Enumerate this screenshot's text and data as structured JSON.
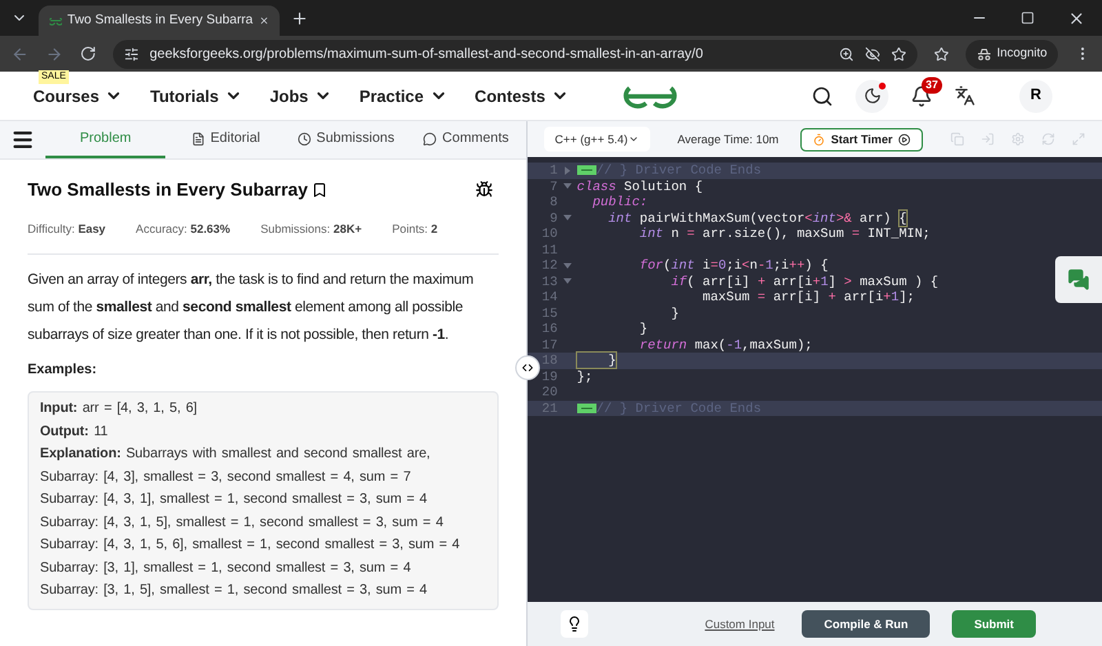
{
  "browser": {
    "tab_title": "Two Smallests in Every Subarra",
    "url": "geeksforgeeks.org/problems/maximum-sum-of-smallest-and-second-smallest-in-an-array/0",
    "incognito_label": "Incognito"
  },
  "nav": {
    "items": [
      {
        "label": "Courses",
        "badge": "SALE"
      },
      {
        "label": "Tutorials"
      },
      {
        "label": "Jobs"
      },
      {
        "label": "Practice"
      },
      {
        "label": "Contests"
      }
    ],
    "notifications": "37",
    "avatar": "R"
  },
  "problem_tabs": [
    {
      "label": "Problem",
      "kind": "problem",
      "selected": true
    },
    {
      "label": "Editorial",
      "kind": "editorial",
      "selected": false
    },
    {
      "label": "Submissions",
      "kind": "submissions",
      "selected": false
    },
    {
      "label": "Comments",
      "kind": "comments",
      "selected": false
    }
  ],
  "problem": {
    "title": "Two Smallests in Every Subarray",
    "meta": [
      {
        "label": "Difficulty: ",
        "value": "Easy"
      },
      {
        "label": "Accuracy: ",
        "value": "52.63%"
      },
      {
        "label": "Submissions: ",
        "value": "28K+"
      },
      {
        "label": "Points: ",
        "value": "2"
      }
    ],
    "description": "Given an array of integers **arr,** the task is to find and return the maximum sum of the **smallest** and **second smallest** element among all possible subarrays of size greater than one. If it is not possible, then return **-1**.",
    "examples_heading": "Examples:",
    "example_lines": [
      "**Input:** arr = [4, 3, 1, 5, 6]",
      "**Output:** 11",
      "**Explanation:** Subarrays with smallest and second smallest are,",
      "Subarray: [4, 3], smallest = 3, second smallest = 4, sum = 7",
      "Subarray: [4, 3, 1], smallest = 1, second smallest = 3, sum = 4",
      "Subarray: [4, 3, 1, 5], smallest = 1, second smallest = 3, sum = 4",
      "Subarray: [4, 3, 1, 5, 6], smallest = 1, second smallest = 3, sum = 4",
      "Subarray: [3, 1], smallest = 1, second smallest = 3, sum = 4",
      "Subarray: [3, 1, 5], smallest = 1, second smallest = 3, sum = 4"
    ]
  },
  "editor": {
    "language": "C++ (g++ 5.4)",
    "average_time": "Average Time: 10m",
    "timer_button": "Start Timer",
    "custom_input": "Custom Input",
    "compile_button": "Compile & Run",
    "submit_button": "Submit",
    "lines": [
      {
        "number": "1",
        "foldable": true,
        "folded": true,
        "highlighted": true,
        "tokens": [
          {
            "kind": "comment",
            "text": "// } Driver Code Ends"
          }
        ]
      },
      {
        "number": "7",
        "foldable": true,
        "folded": false,
        "highlighted": false,
        "tokens": [
          {
            "kind": "keyword",
            "text": "class"
          },
          {
            "kind": "plain",
            "text": " Solution {"
          }
        ]
      },
      {
        "number": "8",
        "foldable": false,
        "folded": false,
        "highlighted": false,
        "tokens": [
          {
            "kind": "keyword",
            "text": "  public:"
          }
        ]
      },
      {
        "number": "9",
        "foldable": true,
        "folded": false,
        "highlighted": false,
        "tokens": [
          {
            "kind": "type",
            "text": "    int"
          },
          {
            "kind": "plain",
            "text": " pairWithMaxSum(vector"
          },
          {
            "kind": "op",
            "text": "<"
          },
          {
            "kind": "type",
            "text": "int"
          },
          {
            "kind": "op",
            "text": ">&"
          },
          {
            "kind": "plain",
            "text": " arr) "
          },
          {
            "kind": "match",
            "text": "{"
          }
        ]
      },
      {
        "number": "10",
        "foldable": false,
        "folded": false,
        "highlighted": false,
        "tokens": [
          {
            "kind": "type",
            "text": "        int"
          },
          {
            "kind": "plain",
            "text": " n "
          },
          {
            "kind": "op",
            "text": "="
          },
          {
            "kind": "plain",
            "text": " arr.size(), maxSum "
          },
          {
            "kind": "op",
            "text": "="
          },
          {
            "kind": "plain",
            "text": " INT_MIN;"
          }
        ]
      },
      {
        "number": "11",
        "foldable": false,
        "folded": false,
        "highlighted": false
      },
      {
        "number": "12",
        "foldable": true,
        "folded": false,
        "highlighted": false,
        "tokens": [
          {
            "kind": "keyword",
            "text": "        for"
          },
          {
            "kind": "plain",
            "text": "("
          },
          {
            "kind": "type",
            "text": "int"
          },
          {
            "kind": "plain",
            "text": " i"
          },
          {
            "kind": "op",
            "text": "="
          },
          {
            "kind": "num",
            "text": "0"
          },
          {
            "kind": "plain",
            "text": ";i"
          },
          {
            "kind": "op",
            "text": "<"
          },
          {
            "kind": "plain",
            "text": "n"
          },
          {
            "kind": "op",
            "text": "-"
          },
          {
            "kind": "num",
            "text": "1"
          },
          {
            "kind": "plain",
            "text": ";i"
          },
          {
            "kind": "op",
            "text": "++"
          },
          {
            "kind": "plain",
            "text": ") {"
          }
        ]
      },
      {
        "number": "13",
        "foldable": true,
        "folded": false,
        "highlighted": false,
        "tokens": [
          {
            "kind": "keyword",
            "text": "            if"
          },
          {
            "kind": "plain",
            "text": "( arr[i] "
          },
          {
            "kind": "op",
            "text": "+"
          },
          {
            "kind": "plain",
            "text": " arr[i"
          },
          {
            "kind": "op",
            "text": "+"
          },
          {
            "kind": "num",
            "text": "1"
          },
          {
            "kind": "plain",
            "text": "] "
          },
          {
            "kind": "op",
            "text": ">"
          },
          {
            "kind": "plain",
            "text": " maxSum ) {"
          }
        ]
      },
      {
        "number": "14",
        "foldable": false,
        "folded": false,
        "highlighted": false,
        "tokens": [
          {
            "kind": "plain",
            "text": "                maxSum "
          },
          {
            "kind": "op",
            "text": "="
          },
          {
            "kind": "plain",
            "text": " arr[i] "
          },
          {
            "kind": "op",
            "text": "+"
          },
          {
            "kind": "plain",
            "text": " arr[i"
          },
          {
            "kind": "op",
            "text": "+"
          },
          {
            "kind": "num",
            "text": "1"
          },
          {
            "kind": "plain",
            "text": "];"
          }
        ]
      },
      {
        "number": "15",
        "foldable": false,
        "folded": false,
        "highlighted": false,
        "tokens": [
          {
            "kind": "plain",
            "text": "            }"
          }
        ]
      },
      {
        "number": "16",
        "foldable": false,
        "folded": false,
        "highlighted": false,
        "tokens": [
          {
            "kind": "plain",
            "text": "        }"
          }
        ]
      },
      {
        "number": "17",
        "foldable": false,
        "folded": false,
        "highlighted": false,
        "tokens": [
          {
            "kind": "keyword",
            "text": "        return"
          },
          {
            "kind": "plain",
            "text": " max("
          },
          {
            "kind": "num",
            "text": "-1"
          },
          {
            "kind": "plain",
            "text": ",maxSum);"
          }
        ]
      },
      {
        "number": "18",
        "foldable": false,
        "folded": false,
        "highlighted": true,
        "tokens": [
          {
            "kind": "match",
            "text": "    }"
          }
        ]
      },
      {
        "number": "19",
        "foldable": false,
        "folded": false,
        "highlighted": false,
        "tokens": [
          {
            "kind": "plain",
            "text": "};"
          }
        ]
      },
      {
        "number": "20",
        "foldable": false,
        "folded": false,
        "highlighted": false
      },
      {
        "number": "21",
        "foldable": false,
        "folded": true,
        "highlighted": true,
        "tokens": [
          {
            "kind": "comment",
            "text": "// } Driver Code Ends"
          }
        ]
      }
    ]
  }
}
